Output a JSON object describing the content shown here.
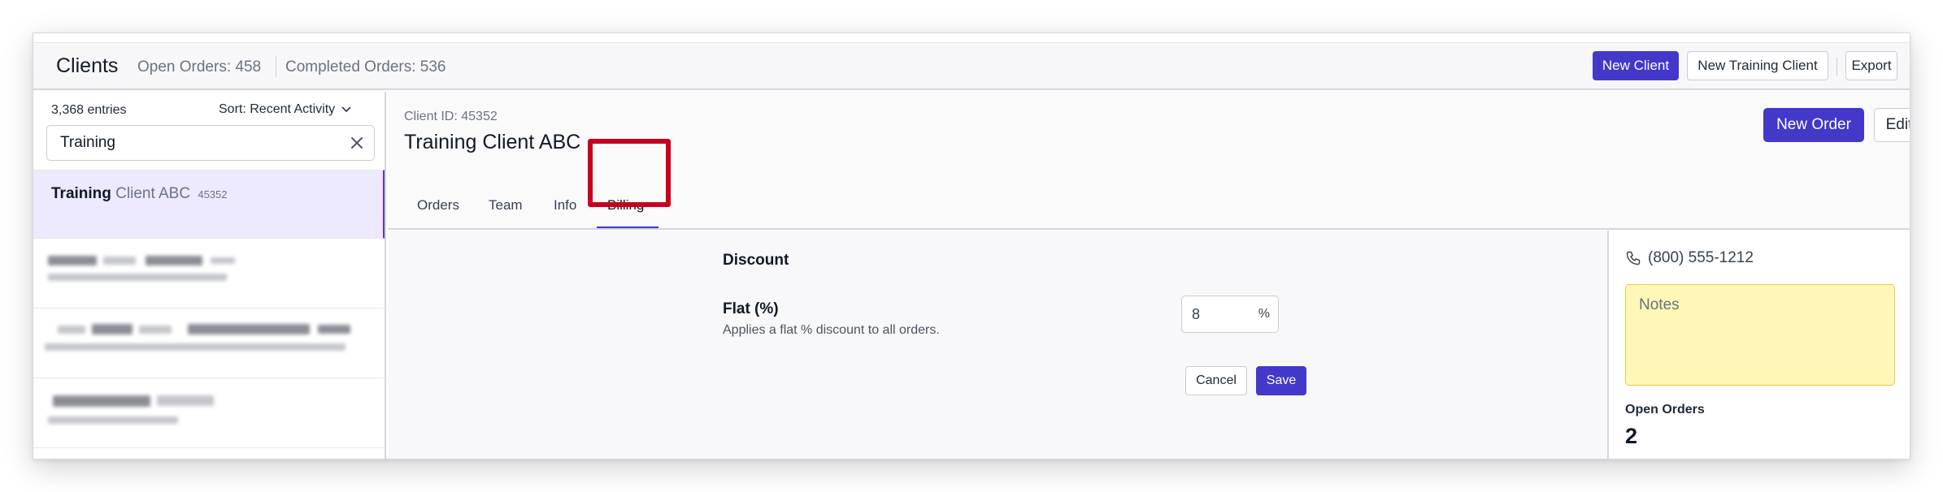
{
  "header": {
    "title": "Clients",
    "open_orders": "Open Orders: 458",
    "completed_orders": "Completed Orders: 536",
    "new_client_label": "New Client",
    "new_training_client_label": "New Training Client",
    "export_label": "Export"
  },
  "sidebar": {
    "entries": "3,368 entries",
    "sort_label": "Sort: Recent Activity",
    "search_value": "Training",
    "active_client": {
      "highlight": "Training",
      "rest": " Client ABC",
      "id": "45352"
    }
  },
  "detail": {
    "client_id": "Client ID: 45352",
    "client_name": "Training Client ABC",
    "new_order_label": "New Order",
    "edit_label": "Edit",
    "tabs": [
      {
        "label": "Orders"
      },
      {
        "label": "Team"
      },
      {
        "label": "Info"
      },
      {
        "label": "Billing",
        "active": true
      }
    ]
  },
  "billing": {
    "section_title": "Discount",
    "field_label": "Flat (%)",
    "field_help": "Applies a flat % discount to all orders.",
    "value": "8",
    "suffix": "%",
    "cancel_label": "Cancel",
    "save_label": "Save"
  },
  "aside": {
    "phone": "(800) 555-1212",
    "notes_placeholder": "Notes",
    "open_orders_label": "Open Orders",
    "open_orders_value": "2"
  },
  "colors": {
    "primary": "#4338ca",
    "selected_row": "#ede9fe",
    "notes_bg": "#fef7b8",
    "highlight_box": "#c8001e"
  }
}
